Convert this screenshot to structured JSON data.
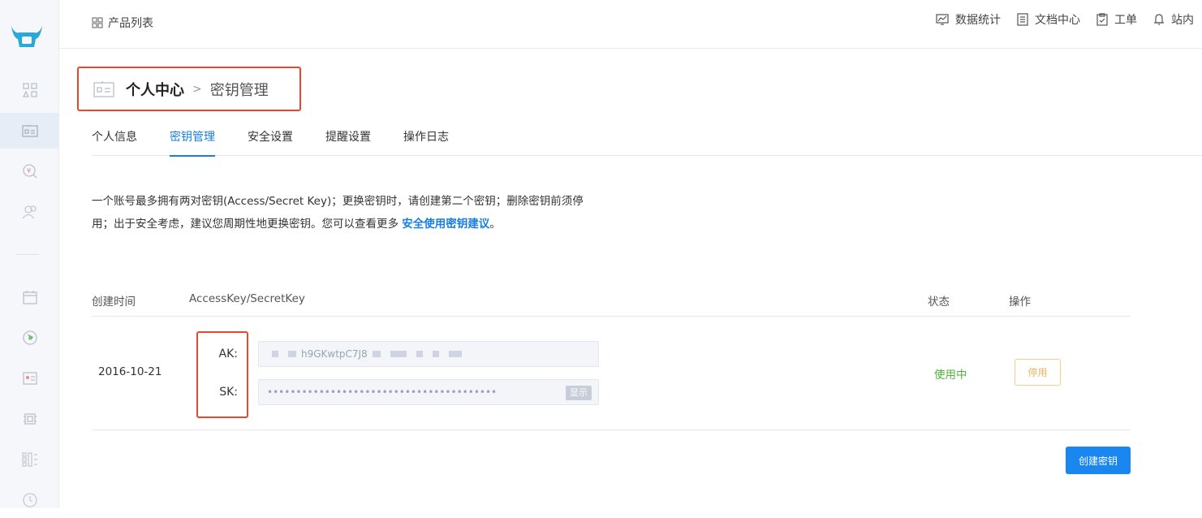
{
  "topbar": {
    "product_list": "产品列表",
    "items": [
      {
        "label": "数据统计",
        "icon": "chart-icon"
      },
      {
        "label": "文档中心",
        "icon": "document-icon"
      },
      {
        "label": "工单",
        "icon": "clipboard-icon"
      },
      {
        "label": "站内",
        "icon": "bell-icon"
      }
    ]
  },
  "sidebar": {
    "icons": [
      "logo-icon",
      "apps-icon",
      "id-card-icon",
      "search-money-icon",
      "users-icon",
      "calendar-icon",
      "globe-icon",
      "certificate-icon",
      "chip-icon",
      "grid-list-icon",
      "clock-icon"
    ],
    "active": "id-card-icon"
  },
  "header": {
    "title": "个人中心",
    "subtitle": "密钥管理"
  },
  "tabs": [
    {
      "label": "个人信息",
      "active": false
    },
    {
      "label": "密钥管理",
      "active": true
    },
    {
      "label": "安全设置",
      "active": false
    },
    {
      "label": "提醒设置",
      "active": false
    },
    {
      "label": "操作日志",
      "active": false
    }
  ],
  "description": {
    "line1": "一个账号最多拥有两对密钥(Access/Secret Key)；更换密钥时，请创建第二个密钥；删除密钥前须停",
    "line2_prefix": "用；出于安全考虑，建议您周期性地更换密钥。您可以查看更多 ",
    "link": "安全使用密钥建议",
    "line2_suffix": "。"
  },
  "table": {
    "headers": {
      "created": "创建时间",
      "keys": "AccessKey/SecretKey",
      "status": "状态",
      "action": "操作"
    },
    "row": {
      "date": "2016-10-21",
      "ak_label": "AK:",
      "ak_value_visible": "h9GKwtpC7J8",
      "sk_label": "SK:",
      "sk_value": "••••••••••••••••••••••••••••••••••••••••",
      "show_label": "显示",
      "status": "使用中",
      "disable_label": "停用"
    }
  },
  "create_button": "创建密钥",
  "colors": {
    "accent": "#1a7ee3",
    "highlight_box": "#e8472a",
    "status_active": "#52b43a",
    "warning": "#e8b45a"
  }
}
